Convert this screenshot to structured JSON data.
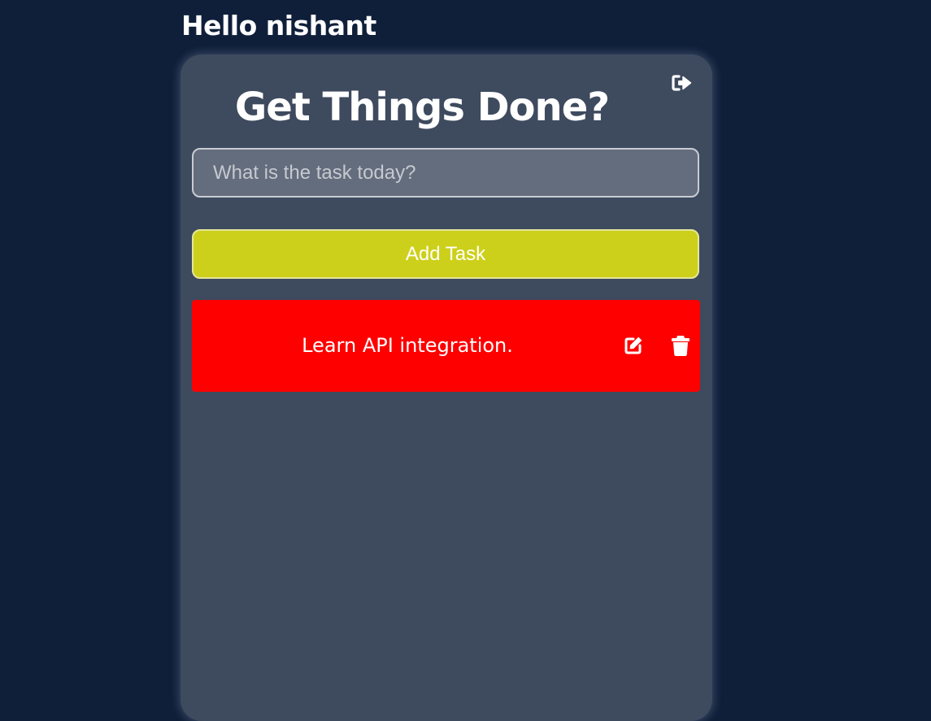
{
  "header": {
    "greeting": "Hello nishant"
  },
  "card": {
    "title": "Get Things Done?",
    "logout_icon": "sign-out-icon",
    "input": {
      "placeholder": "What is the task today?",
      "value": ""
    },
    "add_button_label": "Add Task",
    "tasks": [
      {
        "text": "Learn API integration.",
        "edit_icon": "edit-icon",
        "delete_icon": "trash-icon"
      }
    ]
  },
  "colors": {
    "page_background": "#0f1f3a",
    "card_background": "#3e4a5e",
    "input_background": "#646d7d",
    "add_button": "#cdd01a",
    "task_background": "#ff0000",
    "text": "#ffffff"
  }
}
